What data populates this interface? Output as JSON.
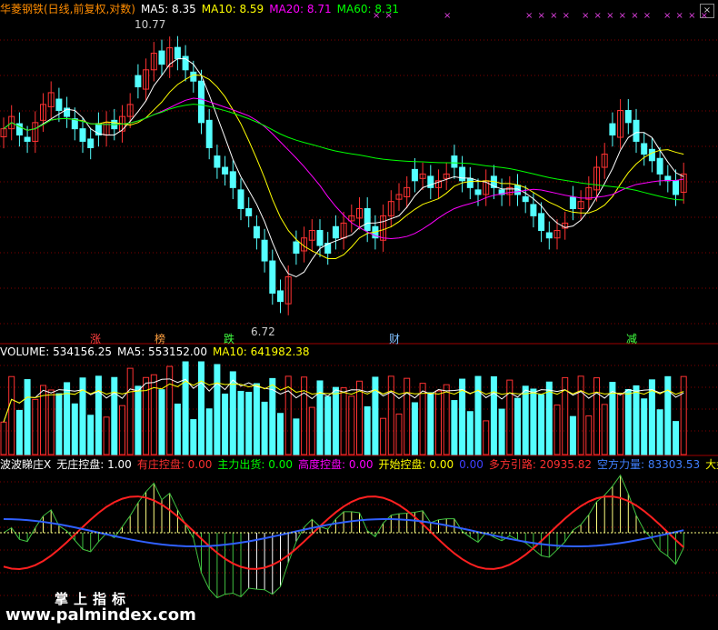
{
  "price_panel": {
    "header": {
      "name": "华菱钢铁(日线,前复权,对数)",
      "ma5": "MA5: 8.35",
      "ma10": "MA10: 8.59",
      "ma20": "MA20: 8.71",
      "ma60": "MA60: 8.31"
    },
    "high_label": "10.77",
    "low_label": "6.72",
    "tags": [
      "涨",
      "榜",
      "跌",
      "财",
      "减"
    ]
  },
  "volume_panel": {
    "header": {
      "volume": "VOLUME: 534156.25",
      "ma5": "MA5: 553152.00",
      "ma10": "MA10: 641982.38"
    }
  },
  "indicator_panel": {
    "header": {
      "name": "波波睇庄X",
      "wuzhuang": "无庄控盘: 1.00",
      "youzhuang": "有庄控盘: 0.00",
      "zhuli": "主力出货: 0.00",
      "gaodu": "高度控盘: 0.00",
      "kaishi": "开始控盘: 0.00",
      "zero": "0.00",
      "duofang": "多方引路: 20935.82",
      "kongfang": "空方力量: 83303.53",
      "dapan": "大盘资金"
    }
  },
  "watermark": {
    "line1": "掌上指标",
    "line2": "www.palmindex.com"
  },
  "x_markers": [
    "× ×",
    "×",
    "× × × ×",
    "× × × × × ×",
    "× × × ×"
  ],
  "close_icon": "×",
  "colors": {
    "up": "#ff3232",
    "down": "#54ffff",
    "ma5": "#ffffff",
    "ma10": "#ffff00",
    "ma20": "#ff00ff",
    "ma60": "#00ff00",
    "grid": "#800000"
  },
  "chart_data": {
    "type": "candlestick",
    "title": "华菱钢铁(日线,前复权,对数)",
    "price_extremes": {
      "high": 10.77,
      "low": 6.72
    },
    "ma_values": {
      "MA5": 8.35,
      "MA10": 8.59,
      "MA20": 8.71,
      "MA60": 8.31
    },
    "closes": [
      9.2,
      9.4,
      9.1,
      9.0,
      9.3,
      9.6,
      9.8,
      9.5,
      9.4,
      9.2,
      9.0,
      8.9,
      9.1,
      9.3,
      9.2,
      9.4,
      9.6,
      9.9,
      10.2,
      10.5,
      10.3,
      10.6,
      10.4,
      10.2,
      10.0,
      9.3,
      8.9,
      8.6,
      8.5,
      8.3,
      8.0,
      7.9,
      7.6,
      7.3,
      6.9,
      6.8,
      7.1,
      7.4,
      7.6,
      7.7,
      7.5,
      7.4,
      7.6,
      7.8,
      7.9,
      8.0,
      7.7,
      7.6,
      7.9,
      8.1,
      8.2,
      8.3,
      8.4,
      8.5,
      8.3,
      8.4,
      8.5,
      8.6,
      8.4,
      8.3,
      8.2,
      8.4,
      8.3,
      8.2,
      8.3,
      8.2,
      8.1,
      7.9,
      7.7,
      7.6,
      7.7,
      7.8,
      8.0,
      8.1,
      8.3,
      8.6,
      8.8,
      9.1,
      9.5,
      9.3,
      9.0,
      8.8,
      8.7,
      8.5,
      8.4,
      8.2,
      8.5
    ],
    "volume_ma": {
      "MA5": 553152.0,
      "MA10": 641982.38
    },
    "last_volume": 534156.25,
    "indicator": {
      "name": "波波睇庄X",
      "无庄控盘": 1.0,
      "有庄控盘": 0.0,
      "主力出货": 0.0,
      "高度控盘": 0.0,
      "开始控盘": 0.0,
      "多方引路": 20935.82,
      "空方力量": 83303.53
    }
  }
}
